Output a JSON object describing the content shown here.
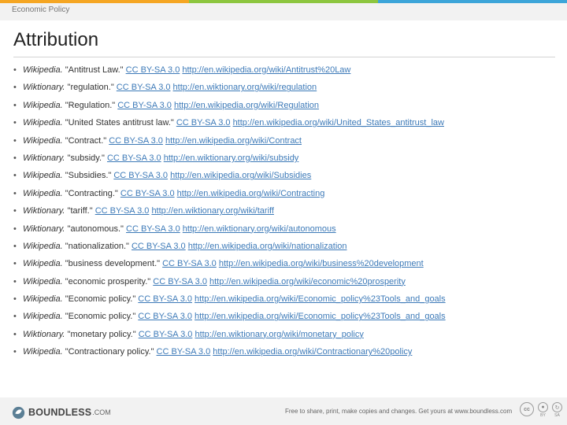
{
  "colors": {
    "band_1": "#f5a623",
    "band_2": "#8dc63f",
    "band_3": "#3da5d9",
    "link": "#3d7ab8",
    "header_bg": "#f2f2f2"
  },
  "header": {
    "text": "Economic Policy"
  },
  "title": "Attribution",
  "attributions": [
    {
      "source": "Wikipedia.",
      "text": " \"Antitrust Law.\" ",
      "license": "CC BY-SA 3.0",
      "url": "http://en.wikipedia.org/wiki/Antitrust%20Law"
    },
    {
      "source": "Wiktionary.",
      "text": " \"regulation.\" ",
      "license": "CC BY-SA 3.0",
      "url": "http://en.wiktionary.org/wiki/regulation"
    },
    {
      "source": "Wikipedia.",
      "text": " \"Regulation.\" ",
      "license": "CC BY-SA 3.0",
      "url": "http://en.wikipedia.org/wiki/Regulation"
    },
    {
      "source": "Wikipedia.",
      "text": " \"United States antitrust law.\" ",
      "license": "CC BY-SA 3.0",
      "url": "http://en.wikipedia.org/wiki/United_States_antitrust_law"
    },
    {
      "source": "Wikipedia.",
      "text": " \"Contract.\" ",
      "license": "CC BY-SA 3.0",
      "url": "http://en.wikipedia.org/wiki/Contract"
    },
    {
      "source": "Wiktionary.",
      "text": " \"subsidy.\" ",
      "license": "CC BY-SA 3.0",
      "url": "http://en.wiktionary.org/wiki/subsidy"
    },
    {
      "source": "Wikipedia.",
      "text": " \"Subsidies.\" ",
      "license": "CC BY-SA 3.0",
      "url": "http://en.wikipedia.org/wiki/Subsidies"
    },
    {
      "source": "Wikipedia.",
      "text": " \"Contracting.\" ",
      "license": "CC BY-SA 3.0",
      "url": "http://en.wikipedia.org/wiki/Contracting"
    },
    {
      "source": "Wiktionary.",
      "text": " \"tariff.\" ",
      "license": "CC BY-SA 3.0",
      "url": "http://en.wiktionary.org/wiki/tariff"
    },
    {
      "source": "Wiktionary.",
      "text": " \"autonomous.\" ",
      "license": "CC BY-SA 3.0",
      "url": "http://en.wiktionary.org/wiki/autonomous"
    },
    {
      "source": "Wikipedia.",
      "text": " \"nationalization.\" ",
      "license": "CC BY-SA 3.0",
      "url": "http://en.wikipedia.org/wiki/nationalization"
    },
    {
      "source": "Wikipedia.",
      "text": " \"business development.\" ",
      "license": "CC BY-SA 3.0",
      "url": "http://en.wikipedia.org/wiki/business%20development"
    },
    {
      "source": "Wikipedia.",
      "text": " \"economic prosperity.\" ",
      "license": "CC BY-SA 3.0",
      "url": "http://en.wikipedia.org/wiki/economic%20prosperity"
    },
    {
      "source": "Wikipedia.",
      "text": " \"Economic policy.\" ",
      "license": "CC BY-SA 3.0",
      "url": "http://en.wikipedia.org/wiki/Economic_policy%23Tools_and_goals"
    },
    {
      "source": "Wikipedia.",
      "text": " \"Economic policy.\" ",
      "license": "CC BY-SA 3.0",
      "url": "http://en.wikipedia.org/wiki/Economic_policy%23Tools_and_goals"
    },
    {
      "source": "Wiktionary.",
      "text": " \"monetary policy.\" ",
      "license": "CC BY-SA 3.0",
      "url": "http://en.wiktionary.org/wiki/monetary_policy"
    },
    {
      "source": "Wikipedia.",
      "text": " \"Contractionary policy.\" ",
      "license": "CC BY-SA 3.0",
      "url": "http://en.wikipedia.org/wiki/Contractionary%20policy"
    }
  ],
  "footer": {
    "logo_text": "BOUNDLESS",
    "logo_domain": ".COM",
    "tagline": "Free to share, print, make copies and changes. Get yours at www.boundless.com",
    "cc_badge": "cc",
    "cc_by_label": "BY",
    "cc_sa_label": "SA"
  }
}
